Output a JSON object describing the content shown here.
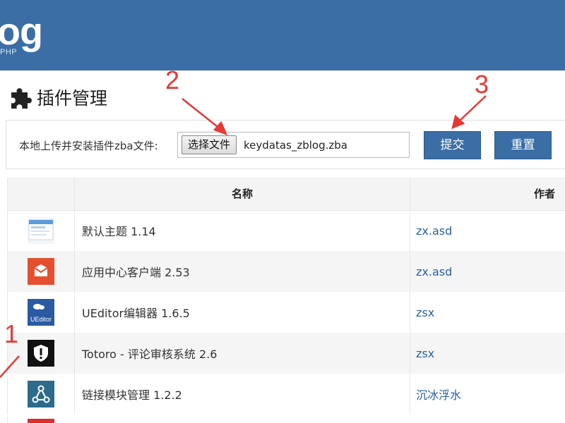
{
  "header": {
    "logo": "og",
    "logo_sub": "PHP"
  },
  "page": {
    "title": "插件管理"
  },
  "upload": {
    "label": "本地上传并安装插件zba文件:",
    "choose_button": "选择文件",
    "file_name": "keydatas_zblog.zba",
    "submit_label": "提交",
    "reset_label": "重置"
  },
  "table": {
    "headers": [
      "",
      "名称",
      "作者"
    ],
    "rows": [
      {
        "name": "默认主题 1.14",
        "author": "zx.asd",
        "icon": "default-theme-icon"
      },
      {
        "name": "应用中心客户端 2.53",
        "author": "zx.asd",
        "icon": "app-center-icon",
        "color": "#e4502f"
      },
      {
        "name": "UEditor编辑器 1.6.5",
        "author": "zsx",
        "icon": "ueditor-icon",
        "icon_text": "UEditor",
        "color": "#2b5aa3"
      },
      {
        "name": "Totoro - 评论审核系统 2.6",
        "author": "zsx",
        "icon": "shield-alert-icon",
        "color": "#111111"
      },
      {
        "name": "链接模块管理 1.2.2",
        "author": "沉冰浮水",
        "icon": "share-nodes-icon",
        "color": "#2d6b8c"
      }
    ]
  },
  "annotations": {
    "one": "1",
    "two": "2",
    "three": "3",
    "color": "#e53935"
  },
  "colors": {
    "brand": "#3a6ea5",
    "link": "#2a5f9e"
  }
}
